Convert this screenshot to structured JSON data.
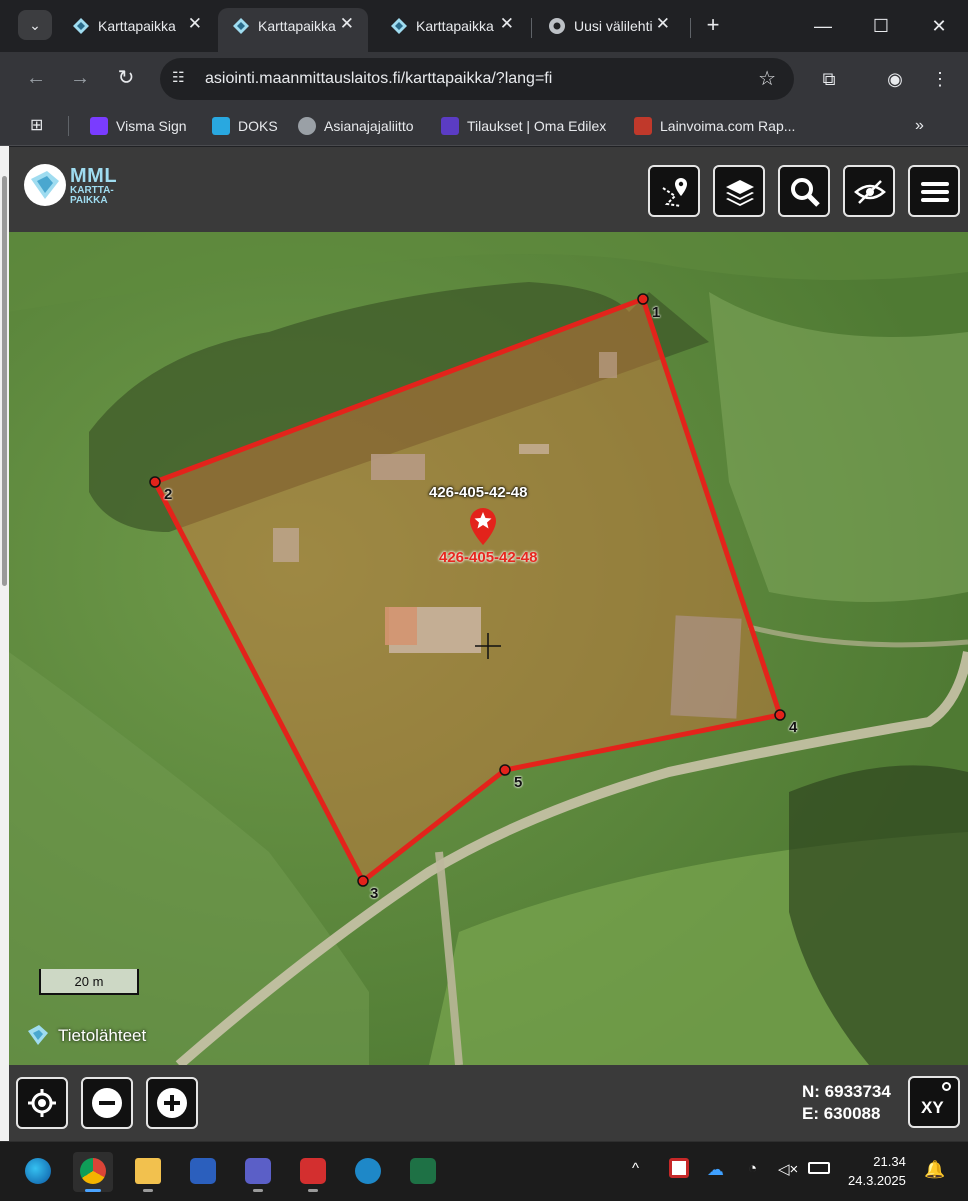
{
  "browser": {
    "tabs": [
      {
        "title": "Karttapaikka",
        "active": false
      },
      {
        "title": "Karttapaikka",
        "active": true
      },
      {
        "title": "Karttapaikka",
        "active": false
      },
      {
        "title": "Uusi välilehti",
        "active": false
      }
    ],
    "url": "asiointi.maanmittauslaitos.fi/karttapaikka/?lang=fi",
    "bookmarks": [
      {
        "label": "Visma Sign",
        "color": "#7a3cff"
      },
      {
        "label": "DOKS",
        "color": "#29a8e0"
      },
      {
        "label": "Asianajajaliitto",
        "color": "#9aa0a6"
      },
      {
        "label": "Tilaukset | Oma Edilex",
        "color": "#5b3cc4"
      },
      {
        "label": "Lainvoima.com Rap...",
        "color": "#c0392b"
      }
    ]
  },
  "app": {
    "logo": {
      "line1": "MML",
      "line2": "KARTTA-",
      "line3": "PAIKKA"
    },
    "toolbar_icons": [
      "route-pin-icon",
      "layers-icon",
      "search-icon",
      "hide-eye-icon",
      "hamburger-menu-icon"
    ]
  },
  "map": {
    "parcel_label_top": "426-405-42-48",
    "parcel_label_marker": "426-405-42-48",
    "vertices": [
      "1",
      "2",
      "3",
      "4",
      "5"
    ],
    "scale_label": "20 m",
    "sources_label": "Tietolähteet",
    "parcel_color": "#e3231b",
    "parcel_fill": "rgba(214,115,60,0.45)"
  },
  "controls": {
    "icons": [
      "locate-icon",
      "zoom-out-icon",
      "zoom-in-icon"
    ],
    "coord_n": "N: 6933734",
    "coord_e": "E: 630088",
    "xy_label": "XY"
  },
  "taskbar": {
    "apps": [
      "edge-icon",
      "chrome-icon",
      "file-explorer-icon",
      "word-icon",
      "teams-icon",
      "pdf-editor-icon",
      "accessibility-app-icon",
      "excel-icon"
    ],
    "time": "21.34",
    "date": "24.3.2025"
  }
}
